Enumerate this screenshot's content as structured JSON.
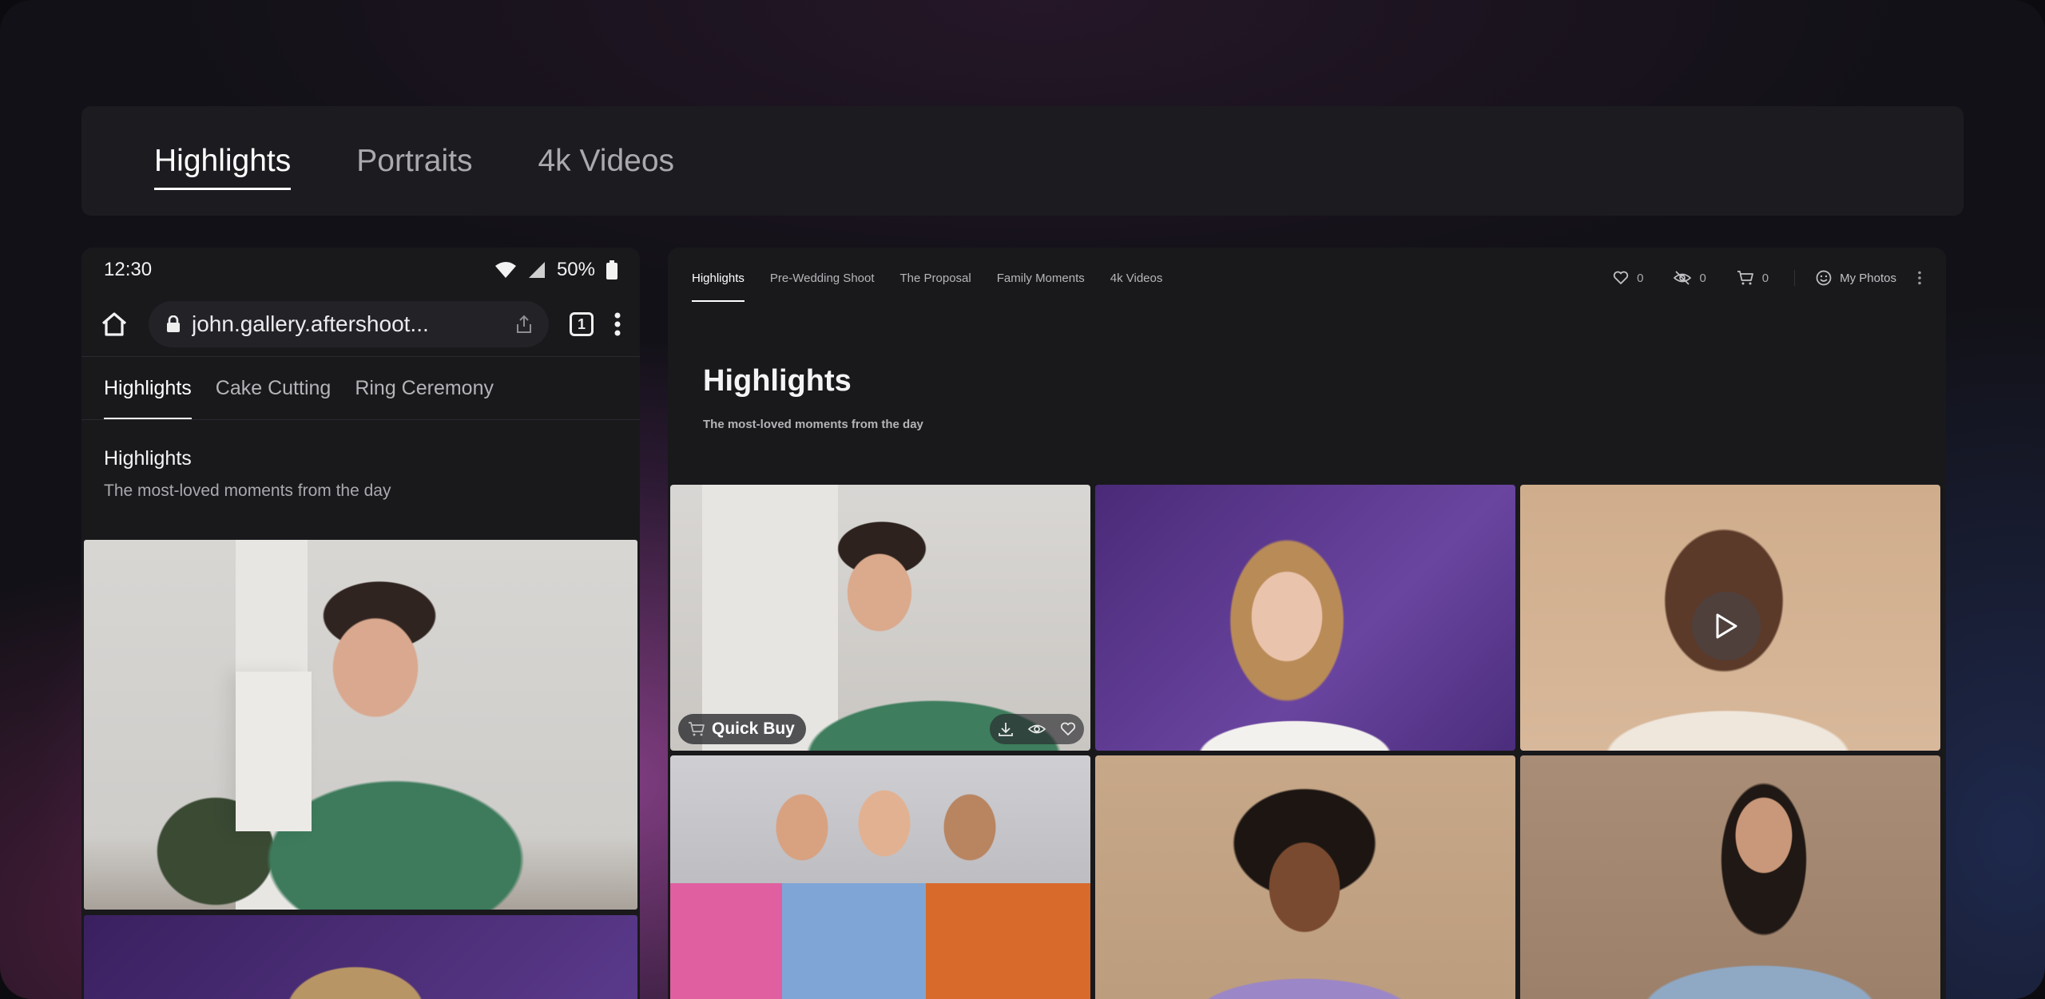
{
  "top_tabs": [
    {
      "label": "Highlights",
      "active": true
    },
    {
      "label": "Portraits",
      "active": false
    },
    {
      "label": "4k Videos",
      "active": false
    }
  ],
  "phone": {
    "status_time": "12:30",
    "battery": "50%",
    "url": "john.gallery.aftershoot...",
    "tab_count": "1",
    "tabs": [
      {
        "label": "Highlights",
        "active": true
      },
      {
        "label": "Cake Cutting",
        "active": false
      },
      {
        "label": "Ring Ceremony",
        "active": false
      }
    ],
    "section_title": "Highlights",
    "section_subtitle": "The most-loved moments from the day"
  },
  "desktop": {
    "tabs": [
      {
        "label": "Highlights",
        "active": true
      },
      {
        "label": "Pre-Wedding Shoot",
        "active": false
      },
      {
        "label": "The Proposal",
        "active": false
      },
      {
        "label": "Family Moments",
        "active": false
      },
      {
        "label": "4k Videos",
        "active": false
      }
    ],
    "favorites_count": "0",
    "hidden_count": "0",
    "cart_count": "0",
    "my_photos_label": "My Photos",
    "section_title": "Highlights",
    "section_subtitle": "The most-loved moments from the day",
    "quick_buy_label": "Quick Buy"
  },
  "colors": {
    "panel": "#19191c",
    "topbar": "#1c1c20",
    "accent": "#ffffff"
  },
  "icons": [
    "home-icon",
    "lock-icon",
    "share-icon",
    "tabs-icon",
    "more-vertical-icon",
    "wifi-icon",
    "signal-icon",
    "battery-icon",
    "heart-icon",
    "eye-off-icon",
    "cart-icon",
    "smile-icon",
    "download-icon",
    "eye-icon",
    "play-icon"
  ]
}
